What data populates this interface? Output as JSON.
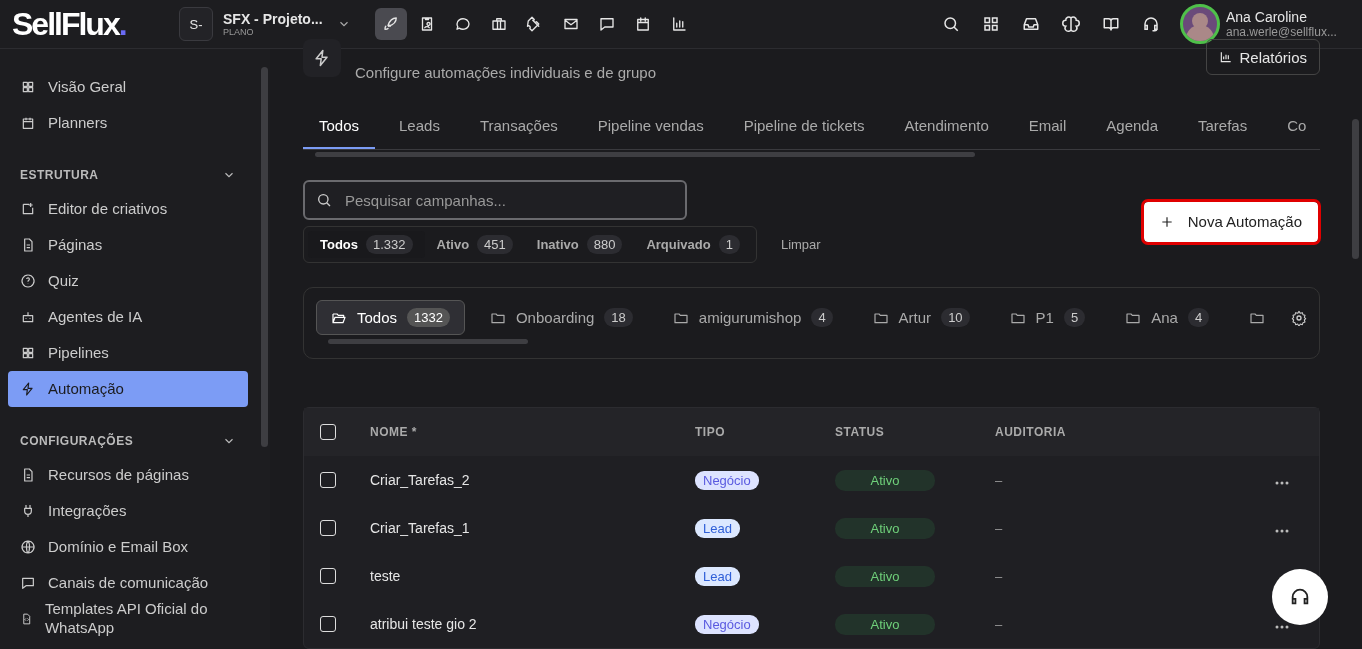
{
  "header": {
    "logo": "SellFlux",
    "logo_dot": ".",
    "workspace": {
      "initials": "S-",
      "name": "SFX - Projeto...",
      "plan": "PLANO"
    },
    "app_nav": [
      {
        "selected": true
      },
      {
        "selected": false
      },
      {
        "selected": false
      },
      {
        "selected": false
      },
      {
        "selected": false
      },
      {
        "selected": false
      },
      {
        "selected": false
      },
      {
        "selected": false
      },
      {
        "selected": false
      }
    ],
    "user": {
      "name": "Ana Caroline",
      "email": "ana.werle@sellflux..."
    }
  },
  "sidebar": {
    "items": [
      {
        "label": "Visão Geral",
        "selected": false
      },
      {
        "label": "Planners",
        "selected": false
      }
    ],
    "sections": [
      {
        "title": "ESTRUTURA",
        "expanded": true,
        "items": [
          {
            "label": "Editor de criativos",
            "selected": false
          },
          {
            "label": "Páginas",
            "selected": false
          },
          {
            "label": "Quiz",
            "selected": false
          },
          {
            "label": "Agentes de IA",
            "selected": false
          },
          {
            "label": "Pipelines",
            "selected": false
          },
          {
            "label": "Automação",
            "selected": true
          }
        ]
      },
      {
        "title": "CONFIGURAÇÕES",
        "expanded": true,
        "items": [
          {
            "label": "Recursos de páginas",
            "selected": false
          },
          {
            "label": "Integrações",
            "selected": false
          },
          {
            "label": "Domínio e Email Box",
            "selected": false
          },
          {
            "label": "Canais de comunicação",
            "selected": false
          },
          {
            "label": "Templates API Oficial do WhatsApp",
            "selected": false
          }
        ]
      }
    ]
  },
  "page": {
    "subtitle": "Configure automações individuais e de grupo",
    "reports_button": "Relatórios"
  },
  "tabs": [
    {
      "label": "Todos",
      "selected": true
    },
    {
      "label": "Leads",
      "selected": false
    },
    {
      "label": "Transações",
      "selected": false
    },
    {
      "label": "Pipeline vendas",
      "selected": false
    },
    {
      "label": "Pipeline de tickets",
      "selected": false
    },
    {
      "label": "Atendimento",
      "selected": false
    },
    {
      "label": "Email",
      "selected": false
    },
    {
      "label": "Agenda",
      "selected": false
    },
    {
      "label": "Tarefas",
      "selected": false
    },
    {
      "label": "Co",
      "selected": false
    }
  ],
  "search": {
    "placeholder": "Pesquisar campanhas..."
  },
  "status_filters": [
    {
      "label": "Todos",
      "count": "1.332",
      "selected": true
    },
    {
      "label": "Ativo",
      "count": "451",
      "selected": false
    },
    {
      "label": "Inativo",
      "count": "880",
      "selected": false
    },
    {
      "label": "Arquivado",
      "count": "1",
      "selected": false
    }
  ],
  "clear_button": "Limpar",
  "new_button": "Nova Automação",
  "folders": [
    {
      "label": "Todos",
      "count": "1332",
      "selected": true
    },
    {
      "label": "Onboarding",
      "count": "18",
      "selected": false
    },
    {
      "label": "amigurumishop",
      "count": "4",
      "selected": false
    },
    {
      "label": "Artur",
      "count": "10",
      "selected": false
    },
    {
      "label": "P1",
      "count": "5",
      "selected": false
    },
    {
      "label": "Ana",
      "count": "4",
      "selected": false
    },
    {
      "selected": false
    }
  ],
  "table": {
    "columns": [
      "NOME *",
      "TIPO",
      "STATUS",
      "AUDITORIA"
    ],
    "header_checked": false,
    "rows": [
      {
        "checked": false,
        "name": "Criar_Tarefas_2",
        "type": {
          "label": "Negócio",
          "kind": "deal"
        },
        "status": "Ativo",
        "audit": "–",
        "menu": true
      },
      {
        "checked": false,
        "name": "Criar_Tarefas_1",
        "type": {
          "label": "Lead",
          "kind": "lead"
        },
        "status": "Ativo",
        "audit": "–",
        "menu": true
      },
      {
        "checked": false,
        "name": "teste",
        "type": {
          "label": "Lead",
          "kind": "lead"
        },
        "status": "Ativo",
        "audit": "–",
        "menu": false
      },
      {
        "checked": false,
        "name": "atribui teste gio 2",
        "type": {
          "label": "Negócio",
          "kind": "deal"
        },
        "status": "Ativo",
        "audit": "–",
        "menu": true
      }
    ]
  }
}
